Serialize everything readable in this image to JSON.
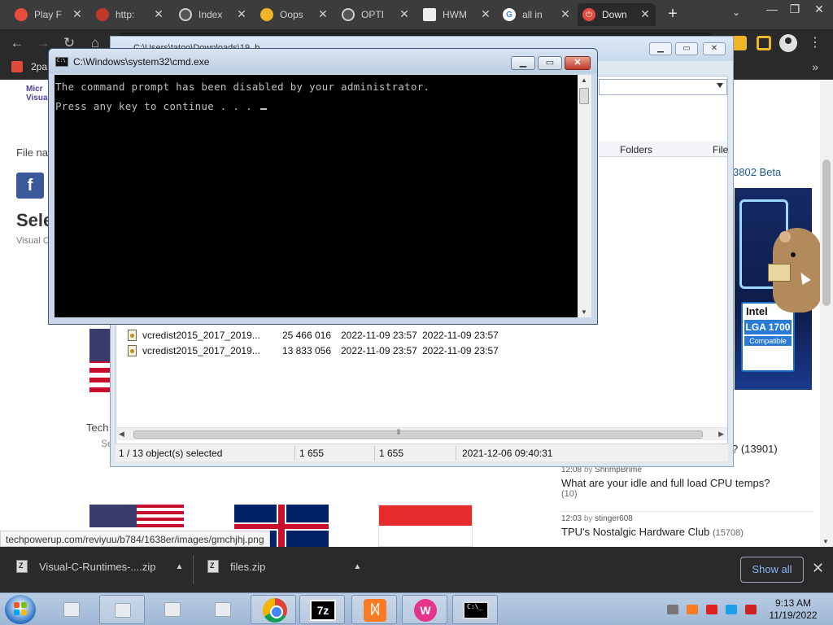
{
  "browser": {
    "tabs": [
      {
        "label": "Play F",
        "favicon_color": "#e74c3c"
      },
      {
        "label": "http:",
        "favicon_color": "#c0392b"
      },
      {
        "label": "Index",
        "favicon_color": "#555555"
      },
      {
        "label": "Oops",
        "favicon_color": "#f0b429"
      },
      {
        "label": "OPTI",
        "favicon_color": "#555555"
      },
      {
        "label": "HWM",
        "favicon_color": "#eeeeee"
      },
      {
        "label": "all in",
        "favicon_color": "#4285f4"
      },
      {
        "label": "Down",
        "favicon_color": "#e74c3c",
        "active": true
      }
    ],
    "bookmark": "2pa",
    "accent": "#8ab4f8"
  },
  "page": {
    "logo_line1": "Micr",
    "logo_line2": "Visua",
    "file_name_label": "File na",
    "facebook": "f",
    "select_heading": "Sele",
    "select_sub": "Visual C",
    "tech_label": "Tech",
    "se_label": "Se",
    "beta_link": "3802 Beta",
    "ad_brand": "Intel",
    "ad_socket": "LGA 1700",
    "ad_compat": "Compatible",
    "forum_partial_count": "? (13901)",
    "forum": [
      {
        "time": "12:08",
        "by": "by",
        "user": "ShrimpBrime",
        "title": "What are your idle and full load CPU temps?",
        "count": "(10)"
      },
      {
        "time": "12:03",
        "by": "by",
        "user": "stinger608",
        "title": "TPU's Nostalgic Hardware Club",
        "count": "(15708)"
      }
    ],
    "status_url": "techpowerup.com/reviyuu/b784/1638er/images/gmchjhj.png"
  },
  "explorer": {
    "title": "C:\\Users\\tatoo\\Downloads\\19_b",
    "folders_header": "Folders",
    "file_header": "File",
    "files": [
      {
        "name": "vcredist2015_2017_2019...",
        "size": "25 466 016",
        "modified": "2022-11-09 23:57",
        "created": "2022-11-09 23:57"
      },
      {
        "name": "vcredist2015_2017_2019...",
        "size": "13 833 056",
        "modified": "2022-11-09 23:57",
        "created": "2022-11-09 23:57"
      }
    ],
    "status": {
      "selection": "1 / 13 object(s) selected",
      "size1": "1 655",
      "size2": "1 655",
      "date": "2021-12-06 09:40:31"
    }
  },
  "cmd": {
    "title": "C:\\Windows\\system32\\cmd.exe",
    "line1": "The command prompt has been disabled by your administrator.",
    "line2": "Press any key to continue . . . "
  },
  "downloads": {
    "items": [
      {
        "name": "Visual-C-Runtimes-....zip"
      },
      {
        "name": "files.zip"
      }
    ],
    "show_all": "Show all"
  },
  "taskbar": {
    "zip_label": "7z",
    "xampp_label": "ᛞ",
    "wamp_label": "W",
    "cmd_label": "C:\\_",
    "time": "9:13 AM",
    "date": "11/19/2022"
  }
}
